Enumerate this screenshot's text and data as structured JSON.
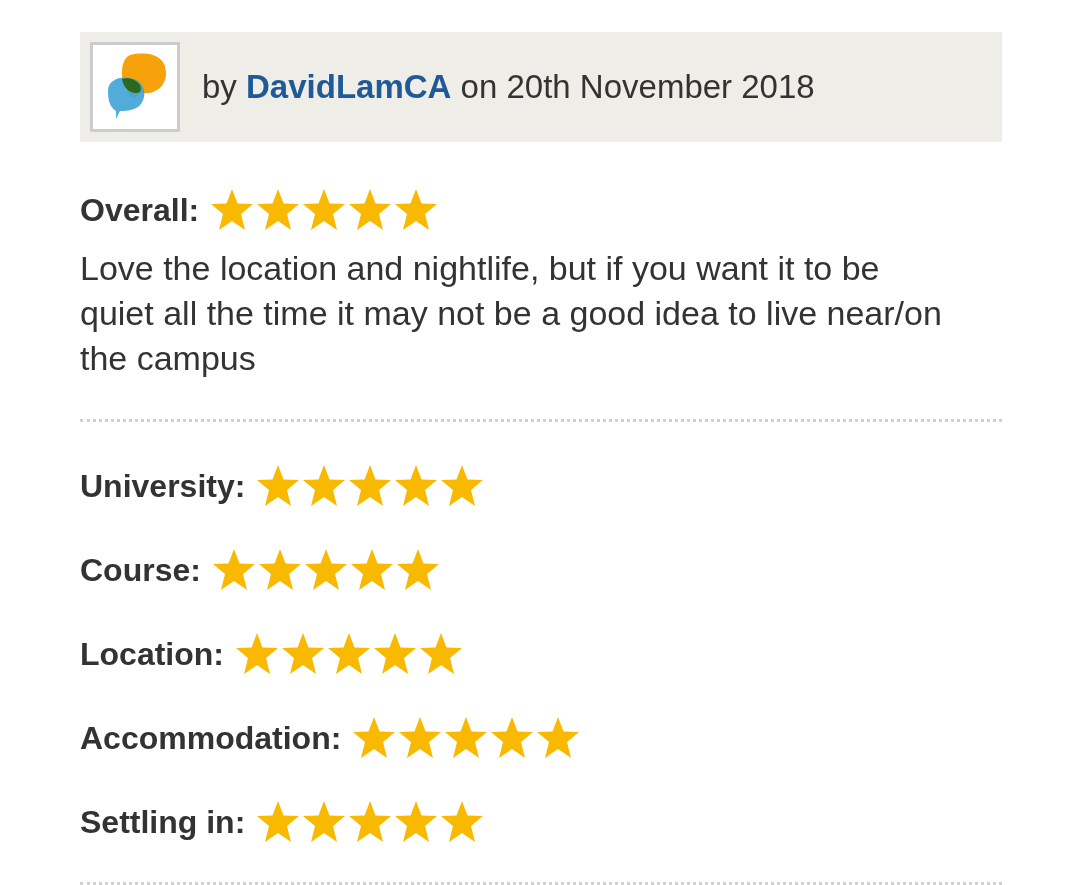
{
  "review": {
    "byline": {
      "prefix": "by",
      "author": "DavidLamCA",
      "date": "on 20th November 2018"
    },
    "overall": {
      "label": "Overall:",
      "stars": 5
    },
    "text": "Love the location and nightlife, but if you want it to be quiet all the time it may not be a good idea to live near/on the campus",
    "ratings": [
      {
        "label": "University:",
        "stars": 5
      },
      {
        "label": "Course:",
        "stars": 5
      },
      {
        "label": "Location:",
        "stars": 5
      },
      {
        "label": "Accommodation:",
        "stars": 5
      },
      {
        "label": "Settling in:",
        "stars": 5
      }
    ]
  }
}
